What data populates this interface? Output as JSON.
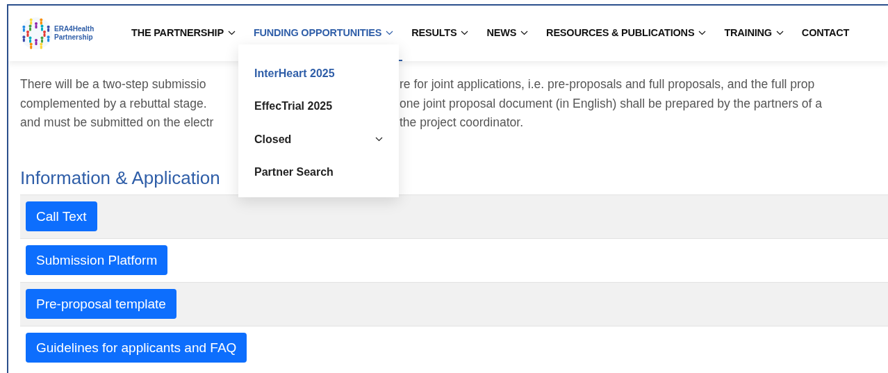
{
  "logo": {
    "line_1": "ERA4Health",
    "line_2": "Partnership"
  },
  "nav": [
    {
      "label": "THE PARTNERSHIP",
      "has_submenu": true,
      "selected": false
    },
    {
      "label": "FUNDING OPPORTUNITIES",
      "has_submenu": true,
      "selected": true
    },
    {
      "label": "RESULTS",
      "has_submenu": true,
      "selected": false
    },
    {
      "label": "NEWS",
      "has_submenu": true,
      "selected": false
    },
    {
      "label": "RESOURCES & PUBLICATIONS",
      "has_submenu": true,
      "selected": false
    },
    {
      "label": "TRAINING",
      "has_submenu": true,
      "selected": false
    },
    {
      "label": "CONTACT",
      "has_submenu": false,
      "selected": false
    }
  ],
  "dropdown": [
    {
      "label": "InterHeart 2025",
      "selected": true,
      "has_submenu": false
    },
    {
      "label": "EffecTrial 2025",
      "selected": false,
      "has_submenu": false
    },
    {
      "label": "Closed",
      "selected": false,
      "has_submenu": true
    },
    {
      "label": "Partner Search",
      "selected": false,
      "has_submenu": false
    }
  ],
  "paragraph_lines": [
    {
      "left": "There will be a two-step submissio",
      "right": "re for joint applications, i.e. pre-proposals and full proposals, and the full prop"
    },
    {
      "left": "complemented by a rebuttal stage.",
      "right": "one joint proposal document (in English) shall be prepared by the partners of a"
    },
    {
      "left": "and must be submitted on the electr",
      "right": "the project coordinator."
    }
  ],
  "heading": "Information & Application",
  "links": [
    "Call Text",
    "Submission Platform",
    "Pre-proposal template",
    "Guidelines for applicants and FAQ"
  ]
}
